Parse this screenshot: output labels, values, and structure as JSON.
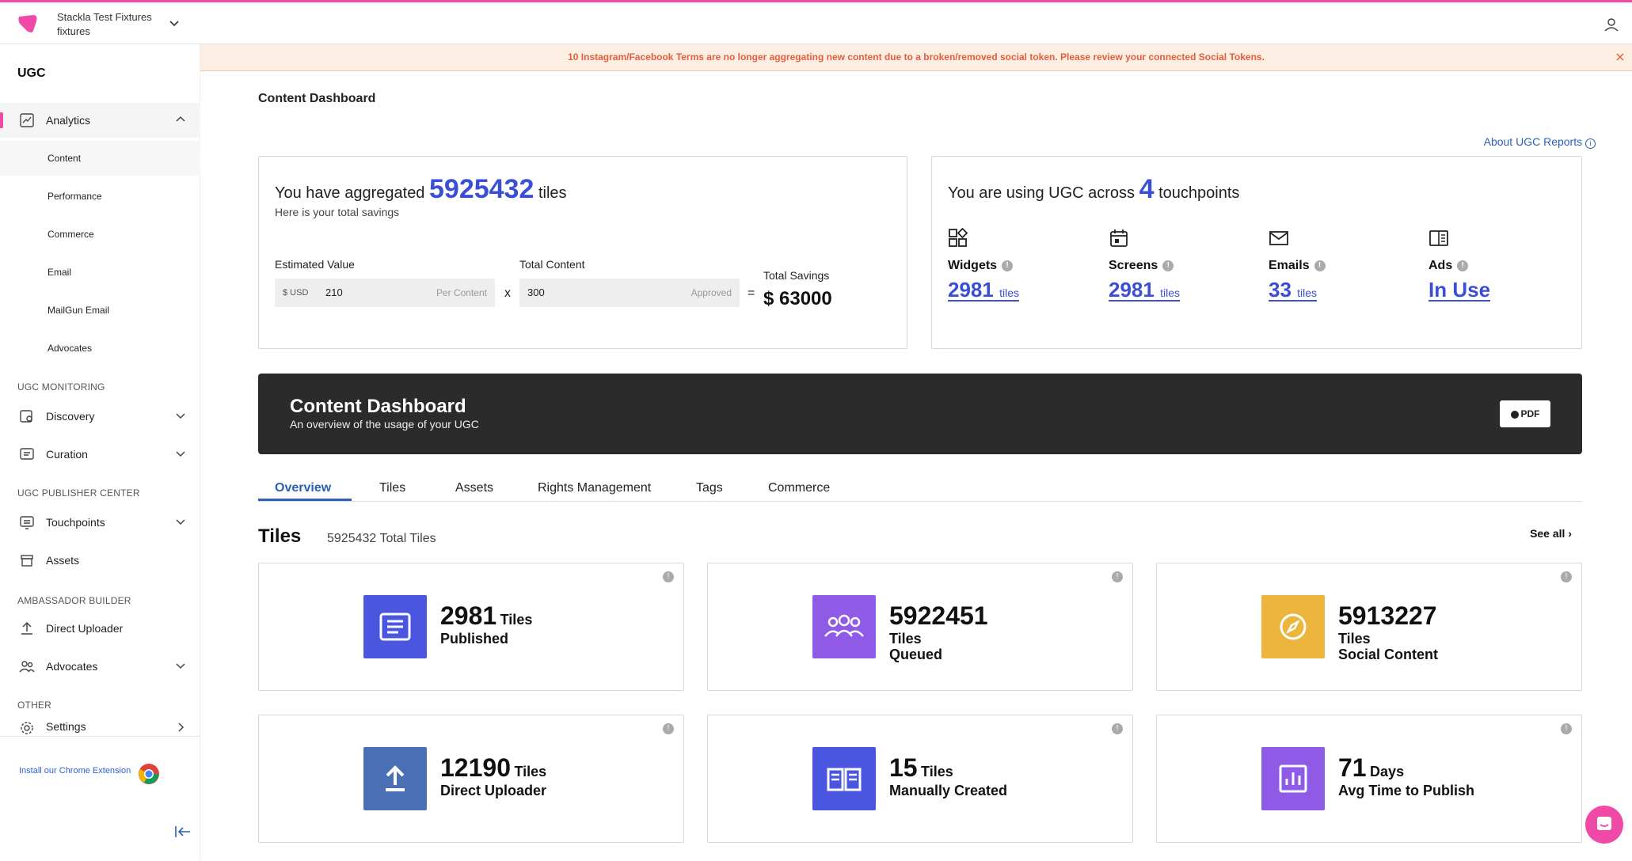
{
  "account": {
    "name": "Stackla Test Fixtures",
    "sub": "fixtures"
  },
  "sidebar": {
    "title": "UGC",
    "analytics": "Analytics",
    "subitems": [
      "Content",
      "Performance",
      "Commerce",
      "Email",
      "MailGun Email",
      "Advocates"
    ],
    "sec_monitoring": "UGC MONITORING",
    "discovery": "Discovery",
    "curation": "Curation",
    "sec_publisher": "UGC PUBLISHER CENTER",
    "touchpoints": "Touchpoints",
    "assets": "Assets",
    "sec_ambassador": "AMBASSADOR BUILDER",
    "direct_uploader": "Direct Uploader",
    "advocates": "Advocates",
    "sec_other": "OTHER",
    "settings": "Settings",
    "chrome": "Install our Chrome Extension"
  },
  "banner": "10 Instagram/Facebook Terms are no longer aggregating new content due to a broken/removed social token. Please review your connected Social Tokens.",
  "page_title": "Content Dashboard",
  "about": "About UGC Reports",
  "aggregate": {
    "pre": "You have aggregated",
    "count": "5925432",
    "post": "tiles",
    "sub": "Here is your total savings",
    "est_label": "Estimated Value",
    "currency": "$ USD",
    "est_value": "210",
    "est_hint": "Per Content",
    "x": "x",
    "total_label": "Total Content",
    "total_value": "300",
    "total_hint": "Approved",
    "eq": "=",
    "savings_label": "Total Savings",
    "savings_value": "$ 63000"
  },
  "touchpoints": {
    "pre": "You are using UGC across",
    "count": "4",
    "post": "touchpoints",
    "items": [
      {
        "name": "Widgets",
        "value": "2981",
        "unit": "tiles",
        "icon": "widgets-icon"
      },
      {
        "name": "Screens",
        "value": "2981",
        "unit": "tiles",
        "icon": "calendar-icon"
      },
      {
        "name": "Emails",
        "value": "33",
        "unit": "tiles",
        "icon": "mail-icon"
      },
      {
        "name": "Ads",
        "value": "In Use",
        "unit": "",
        "icon": "ads-icon"
      }
    ]
  },
  "hero": {
    "title": "Content Dashboard",
    "subtitle": "An overview of the usage of your UGC",
    "pdf": "PDF"
  },
  "tabs": [
    "Overview",
    "Tiles",
    "Assets",
    "Rights Management",
    "Tags",
    "Commerce"
  ],
  "tiles": {
    "heading": "Tiles",
    "total": "5925432 Total Tiles",
    "see_all": "See all",
    "stats": [
      {
        "n": "2981",
        "u": "Tiles",
        "l": "Published",
        "color": "#4a55e0"
      },
      {
        "n": "5922451",
        "u": "",
        "l1": "Tiles",
        "l": "Queued",
        "color": "#8e5ae6"
      },
      {
        "n": "5913227",
        "u": "",
        "l1": "Tiles",
        "l": "Social Content",
        "color": "#ecb53c"
      },
      {
        "n": "12190",
        "u": "Tiles",
        "l": "Direct Uploader",
        "color": "#4a6fb5"
      },
      {
        "n": "15",
        "u": "Tiles",
        "l": "Manually Created",
        "color": "#4a55e0"
      },
      {
        "n": "71",
        "u": "Days",
        "l": "Avg Time to Publish",
        "color": "#8e5ae6"
      }
    ]
  }
}
